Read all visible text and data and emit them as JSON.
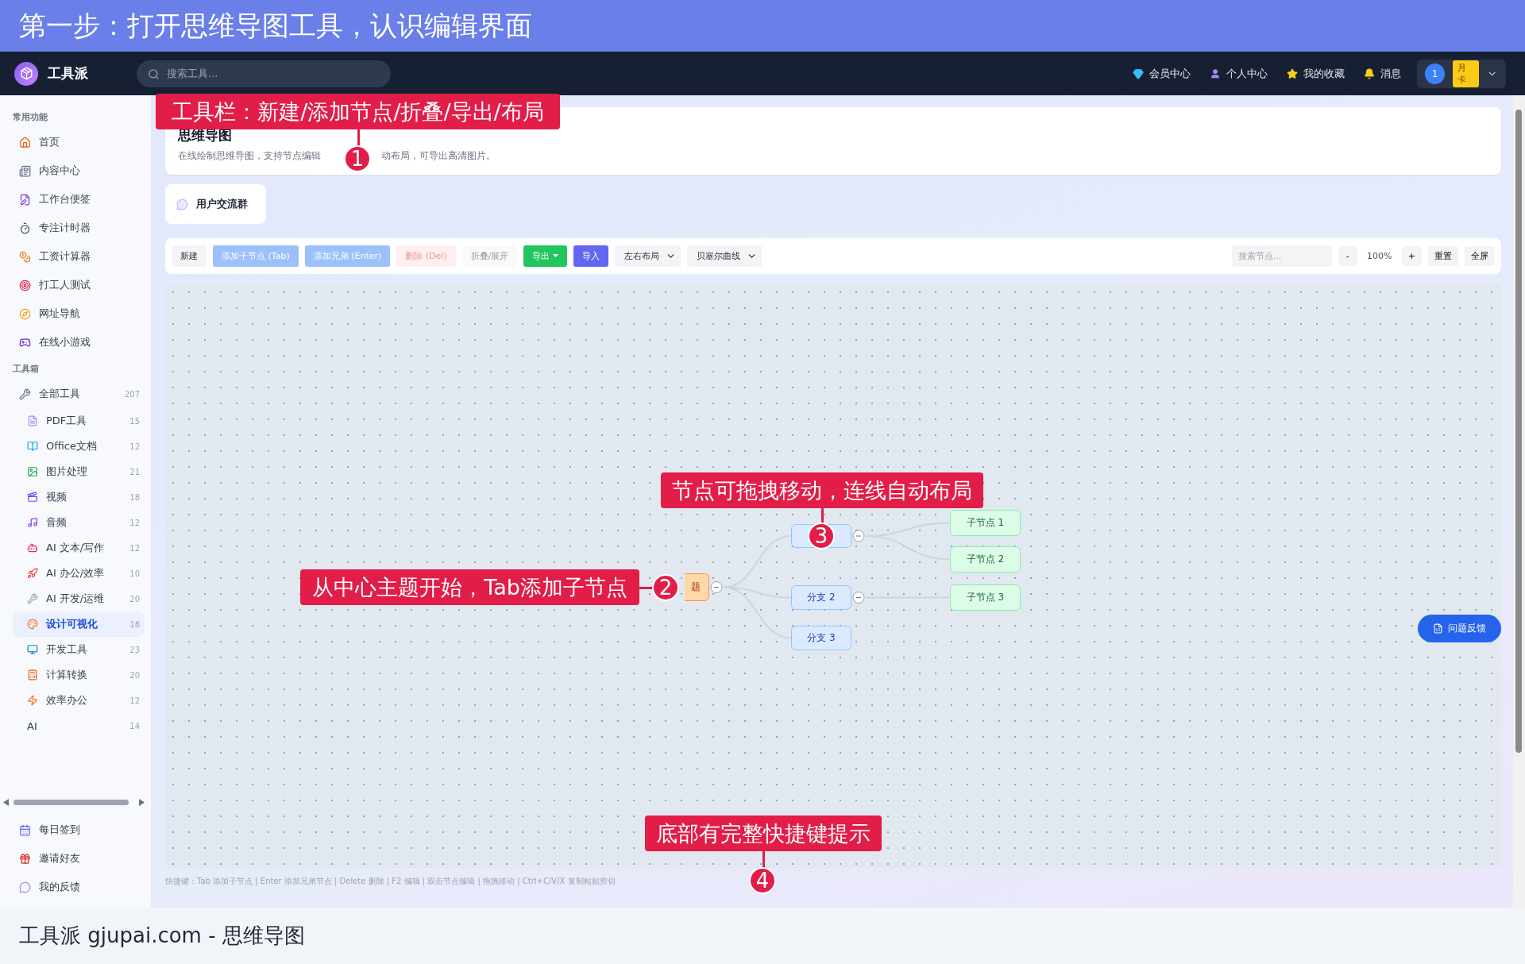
{
  "banner": {
    "title": "第一步：打开思维导图工具，认识编辑界面"
  },
  "header": {
    "brand": "工具派",
    "search": {
      "placeholder": "搜索工具..."
    },
    "links": [
      "会员中心",
      "个人中心",
      "我的收藏",
      "消息"
    ],
    "user": {
      "badge": "1",
      "plan": "月卡"
    }
  },
  "sidebar": {
    "sections": [
      {
        "title": "常用功能",
        "items": [
          {
            "label": "首页",
            "selected": false
          },
          {
            "label": "内容中心",
            "selected": false
          },
          {
            "label": "工作台便签",
            "selected": false
          },
          {
            "label": "专注计时器",
            "selected": false
          },
          {
            "label": "工资计算器",
            "selected": false
          },
          {
            "label": "打工人测试",
            "selected": false
          },
          {
            "label": "网址导航",
            "selected": false
          },
          {
            "label": "在线小游戏",
            "selected": false
          }
        ]
      },
      {
        "title": "工具箱",
        "items": [
          {
            "label": "全部工具",
            "count": "207",
            "selected": false,
            "children": [
              {
                "label": "PDF工具",
                "count": "15",
                "selected": false
              },
              {
                "label": "Office文档",
                "count": "12",
                "selected": false
              },
              {
                "label": "图片处理",
                "count": "21",
                "selected": false
              },
              {
                "label": "视频",
                "count": "18",
                "selected": false
              },
              {
                "label": "音频",
                "count": "12",
                "selected": false
              },
              {
                "label": "AI 文本/写作",
                "count": "12",
                "selected": false
              },
              {
                "label": "AI 办公/效率",
                "count": "10",
                "selected": false
              },
              {
                "label": "AI 开发/运维",
                "count": "20",
                "selected": false
              },
              {
                "label": "设计可视化",
                "count": "18",
                "selected": true
              },
              {
                "label": "开发工具",
                "count": "23",
                "selected": false
              },
              {
                "label": "计算转换",
                "count": "20",
                "selected": false
              },
              {
                "label": "效率办公",
                "count": "12",
                "selected": false
              },
              {
                "label": "AI",
                "count": "14",
                "selected": false
              }
            ]
          }
        ]
      }
    ],
    "bottom_items": [
      {
        "label": "每日签到",
        "selected": false
      },
      {
        "label": "邀请好友",
        "selected": false
      },
      {
        "label": "我的反馈",
        "selected": false
      }
    ]
  },
  "info_card": {
    "title": "思维导图",
    "description_parts": [
      "在线绘制思维导图，支持节点编辑",
      "动布局，可导出高清图片。"
    ]
  },
  "group_card": {
    "label": "用户交流群"
  },
  "toolbar": {
    "buttons": [
      {
        "label": "新建",
        "kind": "plain",
        "disabled": false
      },
      {
        "label": "添加子节点 (Tab)",
        "kind": "primary",
        "disabled": true
      },
      {
        "label": "添加兄弟 (Enter)",
        "kind": "primary",
        "disabled": true
      },
      {
        "label": "删除 (Del)",
        "kind": "danger",
        "disabled": true
      },
      {
        "label": "折叠/展开",
        "kind": "plain",
        "disabled": true
      },
      {
        "label": "导出",
        "kind": "export",
        "disabled": false
      },
      {
        "label": "导入",
        "kind": "import",
        "disabled": false
      }
    ],
    "selects": [
      "左右布局",
      "贝塞尔曲线"
    ],
    "search": {
      "placeholder": "搜索节点..."
    },
    "zoom": {
      "minus": "-",
      "value": "100%",
      "plus": "+"
    },
    "actions": [
      "重置",
      "全屏"
    ]
  },
  "mindmap": {
    "root": {
      "text": "题",
      "expanded": true,
      "children": [
        {
          "expanded": true,
          "children": [
            {
              "text": "子节点 1"
            },
            {
              "text": "子节点 2"
            }
          ]
        },
        {
          "text": "分支 2",
          "expanded": true,
          "children": [
            {
              "text": "子节点 3"
            }
          ]
        },
        {
          "text": "分支 3"
        }
      ]
    }
  },
  "shortcuts": "快捷键：Tab 添加子节点 | Enter 添加兄弟节点 | Delete 删除 | F2 编辑 | 双击节点编辑 | 拖拽移动 | Ctrl+C/V/X 复制粘贴剪切",
  "feedback_button": "问题反馈",
  "annotations": [
    {
      "number": "1",
      "text": "工具栏：新建/添加节点/折叠/导出/布局"
    },
    {
      "number": "2",
      "text": "从中心主题开始，Tab添加子节点"
    },
    {
      "number": "3",
      "text": "节点可拖拽移动，连线自动布局"
    },
    {
      "number": "4",
      "text": "底部有完整快捷键提示"
    }
  ],
  "caption": "工具派 gjupai.com - 思维导图"
}
